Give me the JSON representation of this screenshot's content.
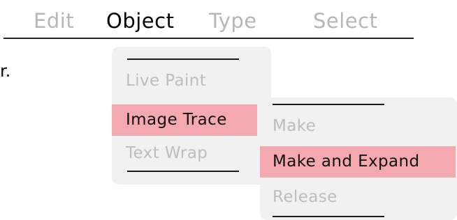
{
  "menubar": {
    "items": [
      {
        "label": "Edit",
        "active": false
      },
      {
        "label": "Object",
        "active": true
      },
      {
        "label": "Type",
        "active": false
      },
      {
        "label": "Select",
        "active": false
      }
    ]
  },
  "partial_text": "r.",
  "object_menu": {
    "items": [
      {
        "label": "Live Paint",
        "highlighted": false
      },
      {
        "label": "Image Trace",
        "highlighted": true
      },
      {
        "label": "Text Wrap",
        "highlighted": false
      }
    ]
  },
  "image_trace_submenu": {
    "items": [
      {
        "label": "Make",
        "highlighted": false
      },
      {
        "label": "Make and Expand",
        "highlighted": true
      },
      {
        "label": "Release",
        "highlighted": false
      }
    ]
  },
  "colors": {
    "highlight": "#f4a9b0",
    "menu_background": "#f1f1f1",
    "disabled_text": "#bdbdbd",
    "active_text": "#000000"
  }
}
